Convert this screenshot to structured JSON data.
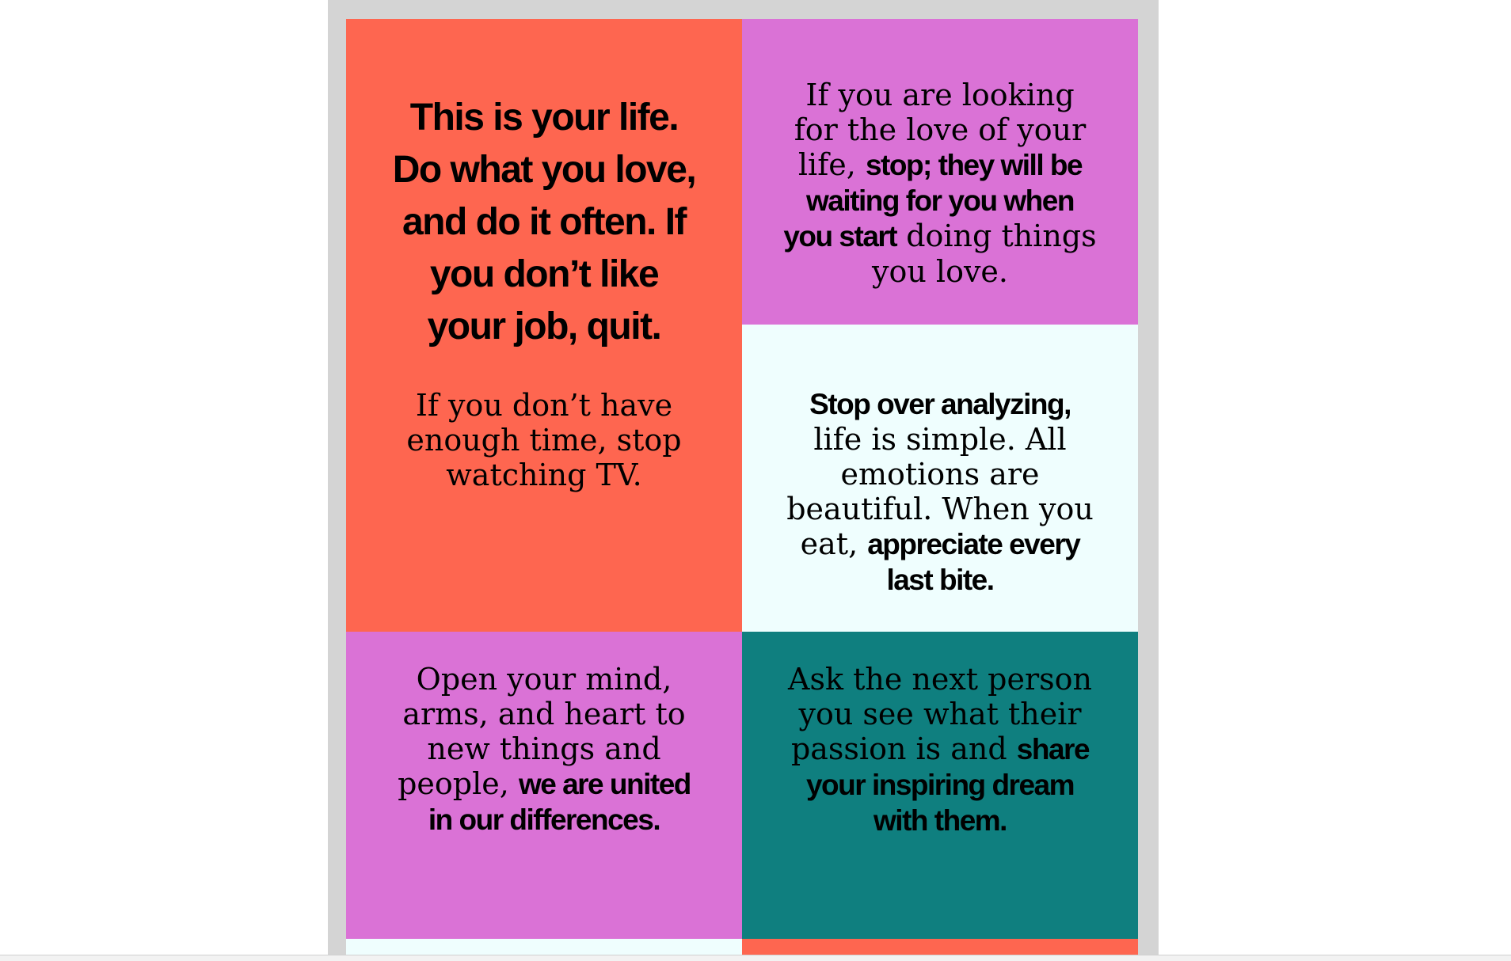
{
  "colors": {
    "frame": "#d4d4d4",
    "coral": "#fe6650",
    "orchid": "#da72d6",
    "mint": "#effefe",
    "teal": "#0f7f7f",
    "text": "#000000"
  },
  "tiles": {
    "a": {
      "background": "coral",
      "headline": "This is your life. Do what you love, and do it often. If you don’t like your job, quit.",
      "sub": "If you don’t have enough time, stop watching TV."
    },
    "b": {
      "background": "orchid",
      "plain_1": "If you are looking for the love of your life, ",
      "bold_1": "stop; they will be waiting for you when you start",
      "plain_2": " doing things you love."
    },
    "c": {
      "background": "mint",
      "bold_1": "Stop over analyzing,",
      "plain_1": " life is simple. All emotions are beautiful. When you eat, ",
      "bold_2": "appreciate every last bite."
    },
    "d": {
      "background": "orchid",
      "plain_1": "Open your mind, arms, and heart to new things and people, ",
      "bold_1": "we are united in our differences."
    },
    "e": {
      "background": "teal",
      "plain_1": "Ask the next person you see what their passion is and ",
      "bold_1": "share your inspiring dream with them."
    },
    "f": {
      "background": "mint"
    },
    "g": {
      "background": "coral"
    }
  }
}
